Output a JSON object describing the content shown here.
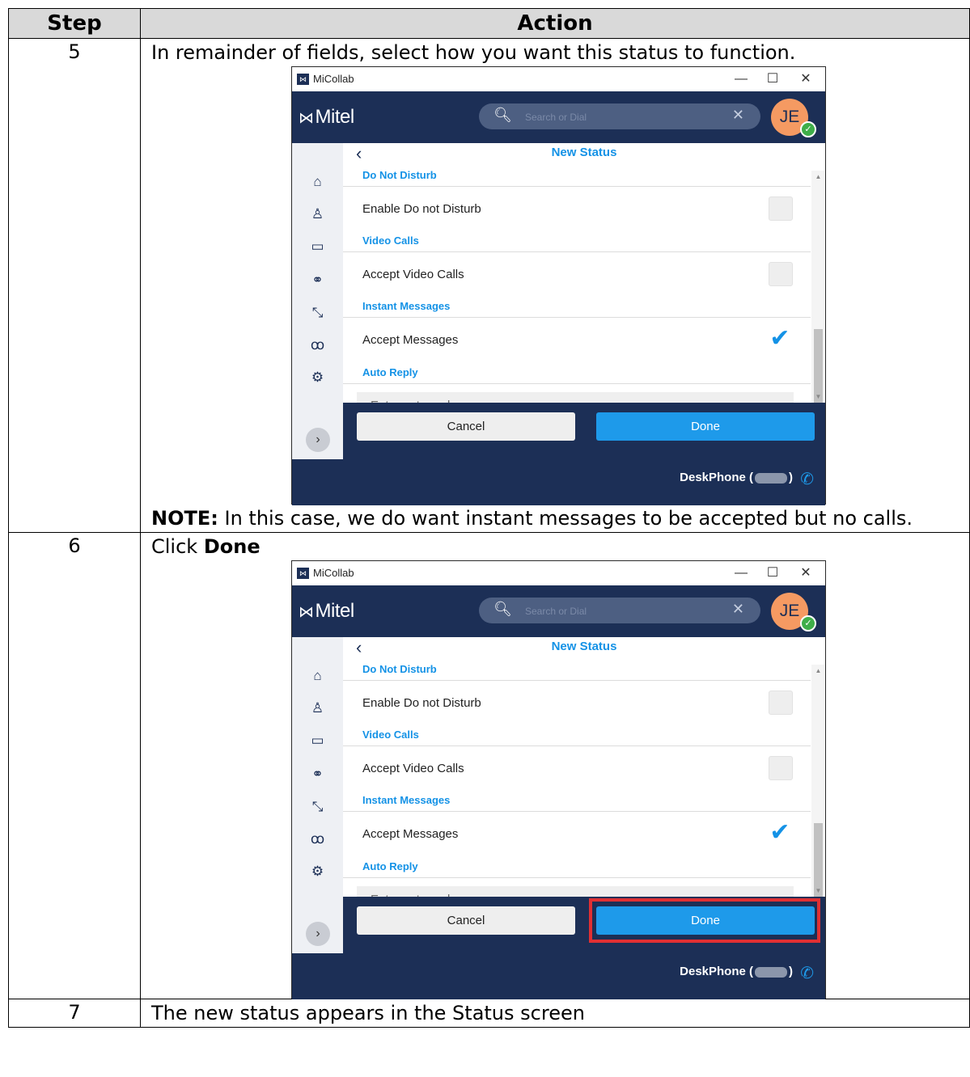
{
  "table": {
    "headers": {
      "step": "Step",
      "action": "Action"
    }
  },
  "steps": [
    {
      "number": "5",
      "text": "In remainder of fields, select how you want this status to function.",
      "note_label": "NOTE:",
      "note_text": " In this case, we do want instant messages to be accepted but no calls."
    },
    {
      "number": "6",
      "text_prefix": "Click ",
      "text_bold": "Done"
    },
    {
      "number": "7",
      "text": "The new status appears in the Status screen"
    }
  ],
  "window": {
    "app_title": "MiCollab",
    "logo_glyph": "⋈",
    "minimize": "—",
    "maximize": "☐",
    "close": "✕",
    "brand": "Mitel",
    "search_placeholder": "Search or Dial",
    "search_icon": "search-icon",
    "clear_glyph": "✕",
    "avatar_initials": "JE",
    "presence": "available",
    "presence_color": "#3fae49",
    "back_glyph": "‹",
    "page_title": "New Status",
    "nav_icons": [
      "home-icon",
      "contacts-icon",
      "chat-icon",
      "conference-icon",
      "call-history-icon",
      "voicemail-icon",
      "settings-icon"
    ],
    "expand_glyph": "›",
    "sections": {
      "dnd": "Do Not Disturb",
      "video": "Video Calls",
      "im": "Instant Messages",
      "auto_reply": "Auto Reply"
    },
    "options": {
      "enable_dnd": "Enable Do not Disturb",
      "accept_video": "Accept Video Calls",
      "accept_messages": "Accept Messages"
    },
    "checked": {
      "enable_dnd": false,
      "accept_video": false,
      "accept_messages": true
    },
    "check_glyph": "✔",
    "auto_reply_placeholder": "Enter auto reply",
    "cancel": "Cancel",
    "done": "Done",
    "device_label": "DeskPhone (",
    "device_suffix": ")",
    "accent": "#1492e6",
    "navy": "#1c2f56"
  }
}
